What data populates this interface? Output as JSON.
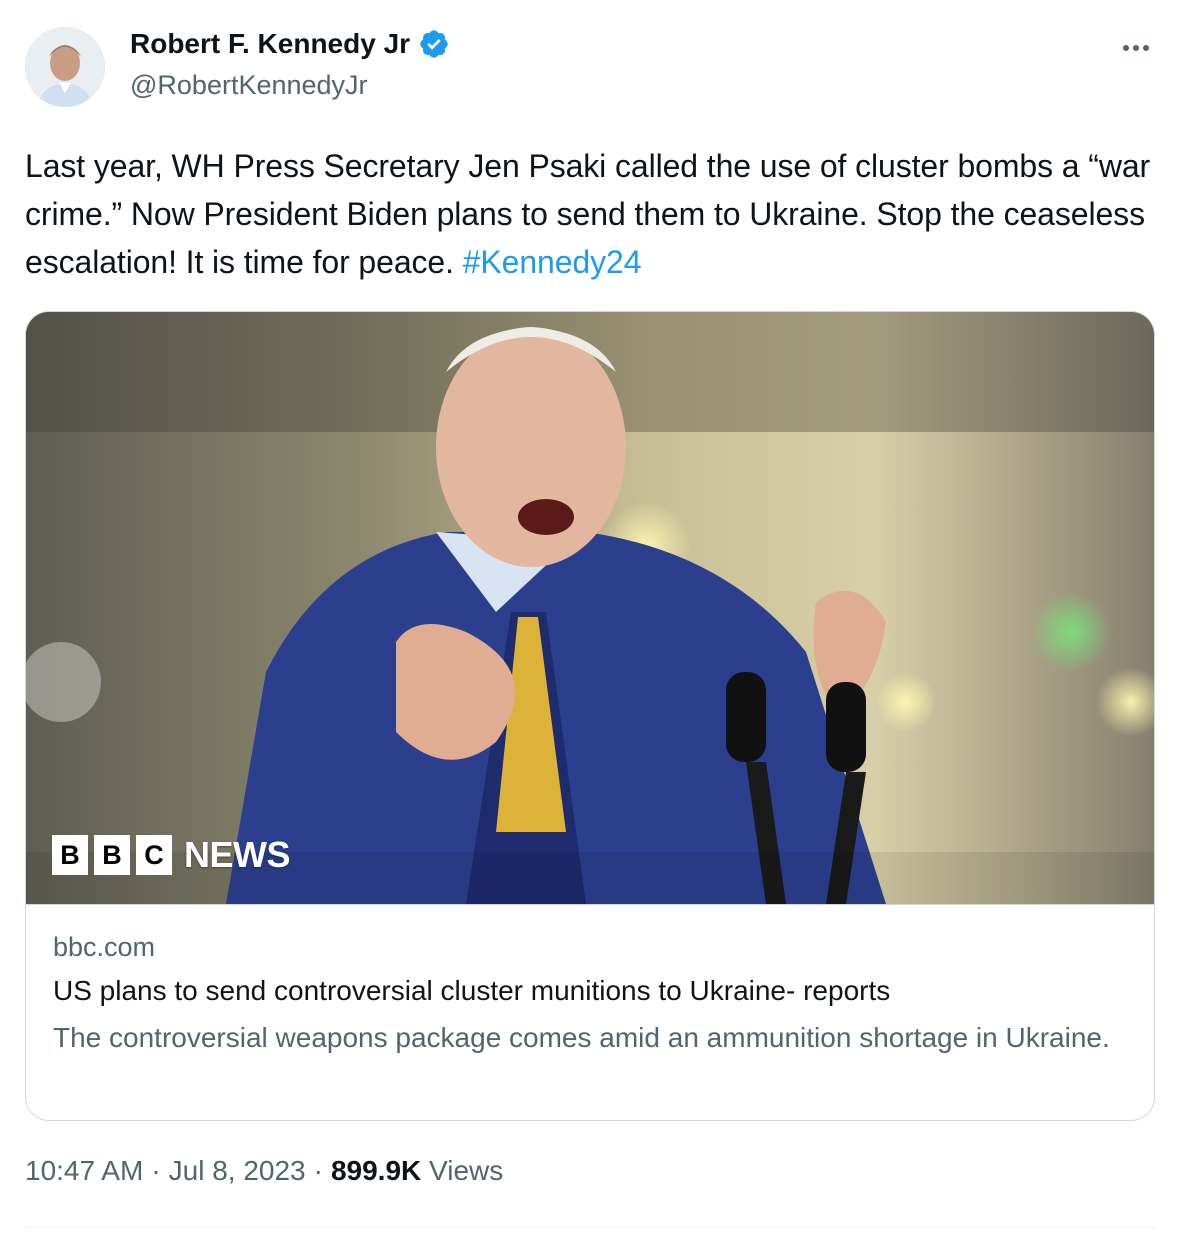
{
  "author": {
    "display_name": "Robert F. Kennedy Jr",
    "handle": "@RobertKennedyJr",
    "verified": true,
    "avatar_icon": "profile-photo"
  },
  "tweet": {
    "text": "Last year, WH Press Secretary Jen Psaki called the use of cluster bombs a “war crime.” Now President Biden plans to send them to Ukraine. Stop the ceaseless escalation! It is time for peace. ",
    "hashtag": "#Kennedy24"
  },
  "card": {
    "image_brand": {
      "b1": "B",
      "b2": "B",
      "b3": "C",
      "news": "NEWS"
    },
    "domain": "bbc.com",
    "title": "US plans to send controversial cluster munitions to Ukraine- reports",
    "description": "The controversial weapons package comes amid an ammunition shortage in Ukraine."
  },
  "meta": {
    "time": "10:47 AM",
    "separator1": "·",
    "date": "Jul 8, 2023",
    "separator2": "·",
    "views_count": "899.9K",
    "views_label": "Views"
  },
  "colors": {
    "link": "#1d9bf0",
    "secondary_text": "#536471",
    "primary_text": "#0f1419",
    "verified_badge": "#1d9bf0",
    "border": "#cfd9de"
  }
}
